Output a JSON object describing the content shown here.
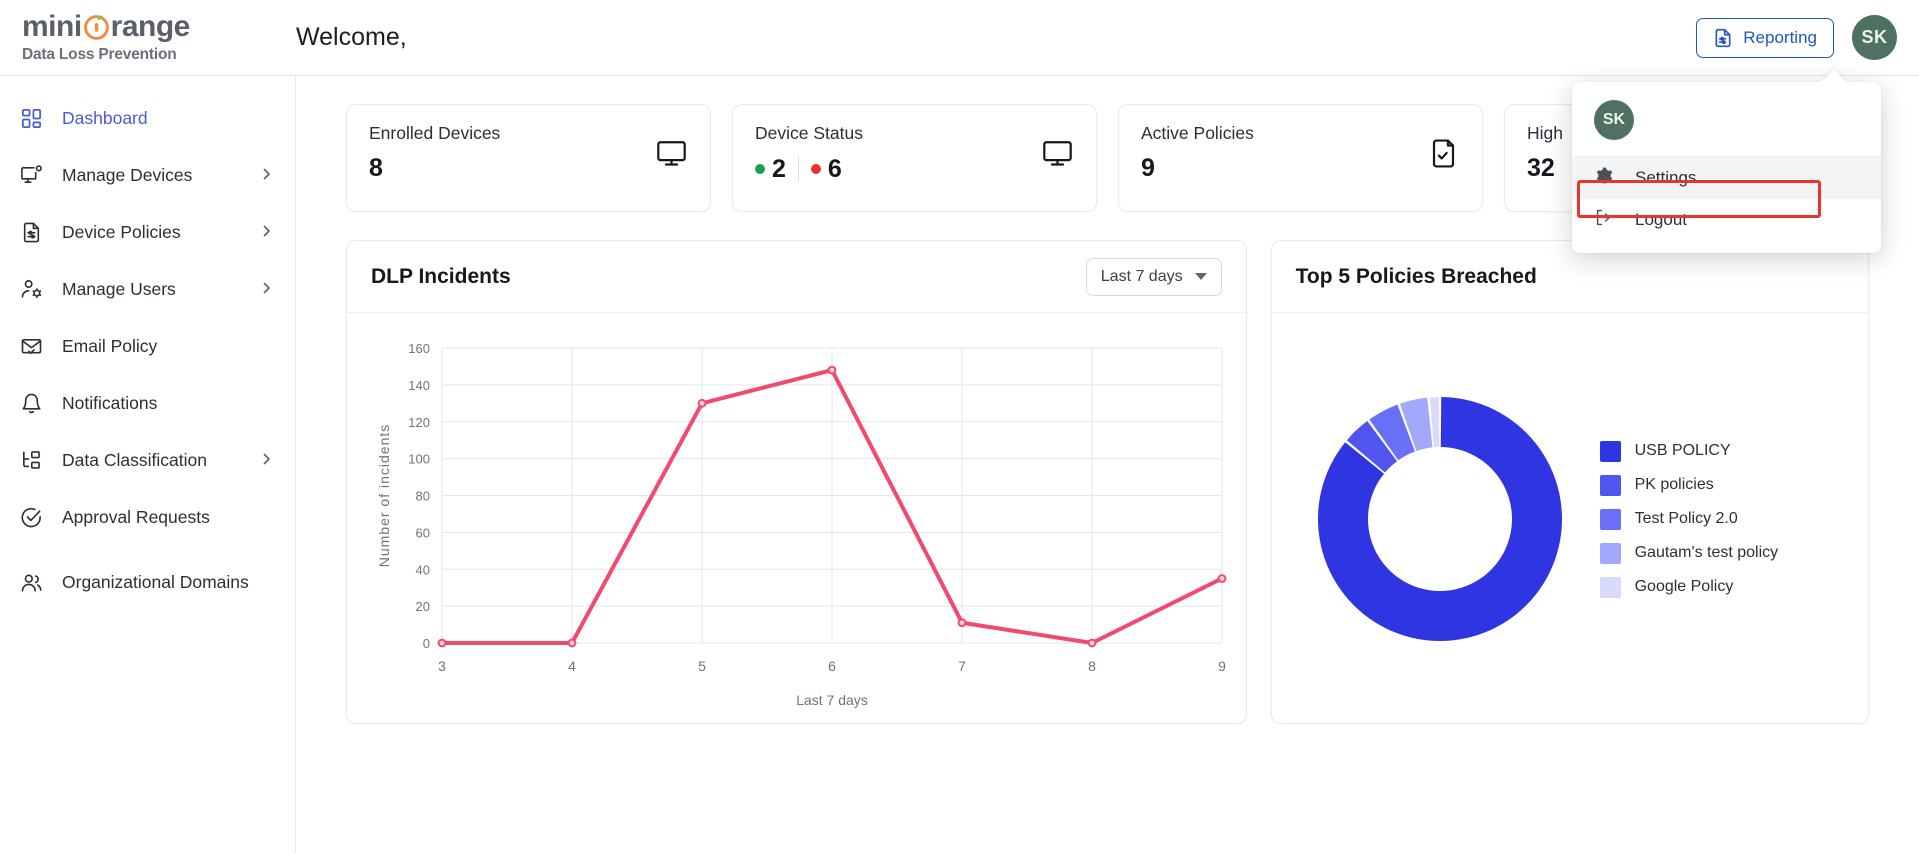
{
  "brand": {
    "name_part1": "mini",
    "name_part2": "range",
    "subtitle": "Data Loss Prevention"
  },
  "header": {
    "welcome": "Welcome,",
    "reporting_label": "Reporting",
    "reporting_icon": "report-document-icon",
    "avatar_initials": "SK",
    "avatar_color": "#4e7161",
    "accent_color": "#1f56c3"
  },
  "profile_menu": {
    "avatar_initials": "SK",
    "items": [
      {
        "label": "Settings",
        "icon": "gear-icon",
        "highlighted": true
      },
      {
        "label": "Logout",
        "icon": "logout-icon",
        "highlighted": false
      }
    ],
    "highlight_outline_color": "#e8342a"
  },
  "sidebar": {
    "items": [
      {
        "label": "Dashboard",
        "icon": "grid-dashboard-icon",
        "active": true,
        "expandable": false
      },
      {
        "label": "Manage Devices",
        "icon": "monitor-alert-icon",
        "active": false,
        "expandable": true
      },
      {
        "label": "Device Policies",
        "icon": "document-settings-icon",
        "active": false,
        "expandable": true
      },
      {
        "label": "Manage Users",
        "icon": "user-settings-icon",
        "active": false,
        "expandable": true
      },
      {
        "label": "Email Policy",
        "icon": "envelope-check-icon",
        "active": false,
        "expandable": false
      },
      {
        "label": "Notifications",
        "icon": "bell-icon",
        "active": false,
        "expandable": false
      },
      {
        "label": "Data Classification",
        "icon": "tree-structure-icon",
        "active": false,
        "expandable": true
      },
      {
        "label": "Approval Requests",
        "icon": "check-circle-icon",
        "active": false,
        "expandable": false
      },
      {
        "label": "Organizational Domains",
        "icon": "users-group-icon",
        "active": false,
        "expandable": false
      }
    ],
    "active_color": "#4b5bd7"
  },
  "stats": [
    {
      "title": "Enrolled Devices",
      "value": "8",
      "icon": "monitor-icon",
      "type": "single"
    },
    {
      "title": "Device Status",
      "icon": "monitor-icon",
      "type": "status",
      "online_value": "2",
      "online_color": "#1aa34a",
      "offline_value": "6",
      "offline_color": "#e8342a"
    },
    {
      "title": "Active Policies",
      "value": "9",
      "icon": "document-check-icon",
      "type": "single"
    },
    {
      "title": "High",
      "value": "32",
      "icon": "alert-icon",
      "type": "single"
    }
  ],
  "incidents_panel": {
    "title": "DLP Incidents",
    "range_label": "Last 7 days",
    "range_icon": "chevron-down-icon"
  },
  "policies_panel": {
    "title": "Top 5 Policies Breached"
  },
  "chart_data": [
    {
      "type": "line",
      "title": "DLP Incidents",
      "xlabel": "Last 7 days",
      "ylabel": "Number of incidents",
      "x": [
        3,
        4,
        5,
        6,
        7,
        8,
        9
      ],
      "xtick_labels": [
        "3",
        "4",
        "5",
        "6",
        "7",
        "8",
        "9"
      ],
      "values": [
        0,
        0,
        130,
        148,
        11,
        0,
        35
      ],
      "ylim": [
        0,
        160
      ],
      "ytick_labels": [
        "0",
        "20",
        "40",
        "60",
        "80",
        "100",
        "120",
        "140",
        "160"
      ],
      "yticks": [
        0,
        20,
        40,
        60,
        80,
        100,
        120,
        140,
        160
      ],
      "line_color": "#f2496f",
      "grid": true,
      "legend": "none"
    },
    {
      "type": "pie",
      "subtype": "donut",
      "title": "Top 5 Policies Breached",
      "legend_position": "right",
      "labels": [
        "USB POLICY",
        "PK policies",
        "Test Policy 2.0",
        "Gautam's test policy",
        "Google Policy"
      ],
      "values": [
        86,
        4,
        4.5,
        4,
        1.5
      ],
      "colors": [
        "#2f35e0",
        "#5055ef",
        "#6a70f5",
        "#a3a8fb",
        "#d7daf9"
      ]
    }
  ]
}
